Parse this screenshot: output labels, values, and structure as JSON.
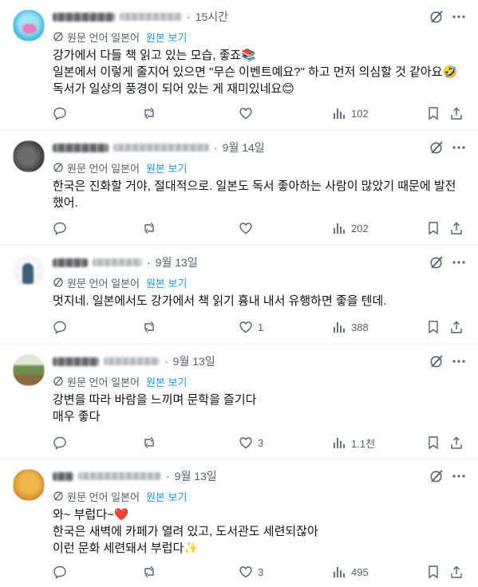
{
  "translation": {
    "label": "원문 언어 일본어",
    "show_original": "원본 보기"
  },
  "posts": [
    {
      "time": "15시간",
      "text": "강가에서 다들 책 읽고 있는 모습, 좋죠📚\n일본에서 이렇게 줄지어 있으면 \"무슨 이벤트예요?\" 하고 먼저 의심할 것 같아요🤣\n독서가 일상의 풍경이 되어 있는 게 재미있네요😊",
      "stats": {
        "replies": "",
        "reposts": "",
        "likes": "",
        "views": "102"
      }
    },
    {
      "time": "9월 14일",
      "text": "한국은 진화할 거야, 절대적으로. 일본도 독서 좋아하는 사람이 많았기 때문에 발전했어.",
      "stats": {
        "replies": "",
        "reposts": "",
        "likes": "",
        "views": "202"
      }
    },
    {
      "time": "9월 13일",
      "text": "멋지네. 일본에서도 강가에서 책 읽기 흉내 내서 유행하면 좋을 텐데.",
      "stats": {
        "replies": "",
        "reposts": "",
        "likes": "1",
        "views": "388"
      }
    },
    {
      "time": "9월 13일",
      "text": "강변을 따라 바람을 느끼며 문학을 즐기다\n매우 좋다",
      "stats": {
        "replies": "",
        "reposts": "",
        "likes": "3",
        "views": "1.1천"
      }
    },
    {
      "time": "9월 13일",
      "text": "와~ 부럽다~❤️\n한국은 새벽에 카페가 열려 있고, 도서관도 세련되잖아\n이런 문화 세련돼서 부럽다✨",
      "stats": {
        "replies": "",
        "reposts": "",
        "likes": "3",
        "views": "495"
      }
    }
  ],
  "colors": {
    "text": "#0f1419",
    "secondary": "#536471",
    "link": "#1d9bf0",
    "border": "#eff3f4"
  },
  "icons": [
    "grok-icon",
    "more-icon",
    "translate-icon",
    "reply-icon",
    "repost-icon",
    "like-icon",
    "views-icon",
    "bookmark-icon",
    "share-icon"
  ]
}
